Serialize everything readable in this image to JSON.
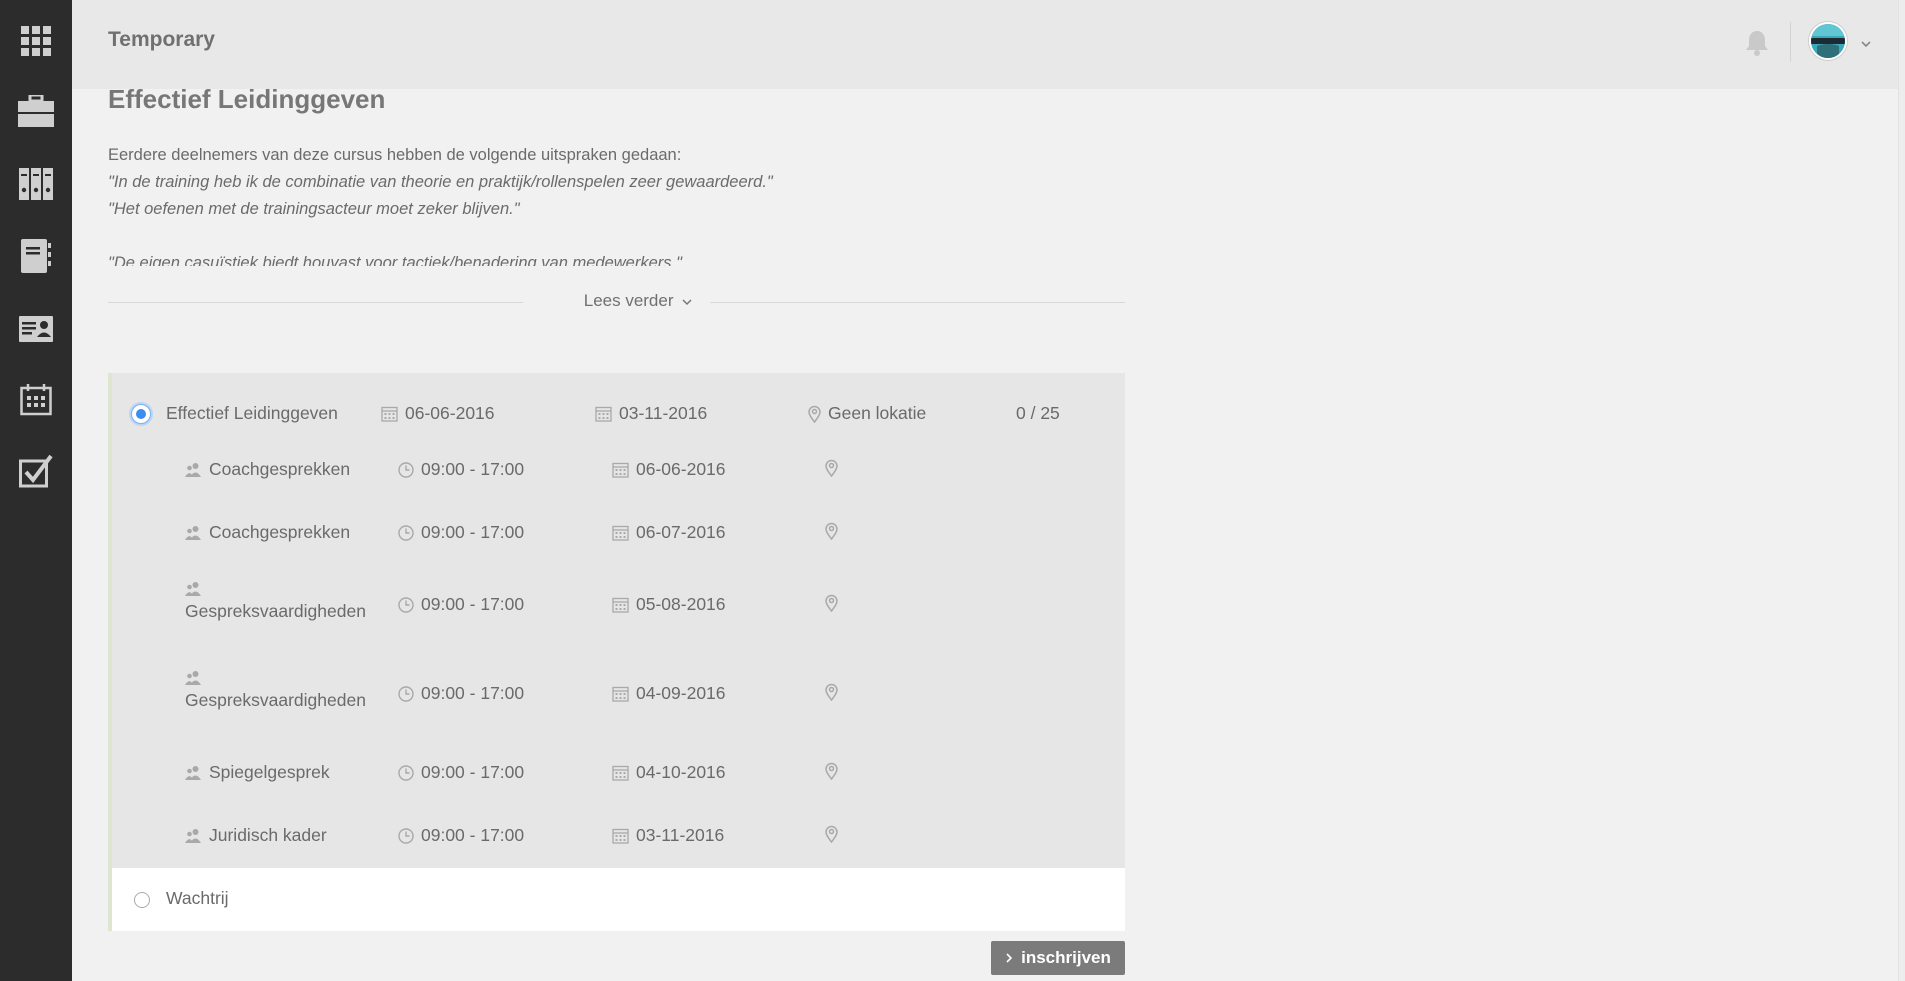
{
  "app": {
    "title": "Temporary"
  },
  "sidebar": {
    "items": [
      {
        "icon": "apps-grid-icon"
      },
      {
        "icon": "briefcase-icon"
      },
      {
        "icon": "binders-icon"
      },
      {
        "icon": "notebook-icon"
      },
      {
        "icon": "contact-card-icon"
      },
      {
        "icon": "calendar-icon"
      },
      {
        "icon": "checkbox-icon"
      }
    ]
  },
  "topbar": {
    "notifications_icon": "bell-icon",
    "avatar_icon": "user-avatar"
  },
  "course": {
    "title": "Effectief Leidinggeven",
    "intro": "Eerdere deelnemers van deze cursus hebben de volgende uitspraken gedaan:",
    "quotes": [
      "\"In de training heb ik de combinatie van theorie en praktijk/rollenspelen zeer gewaardeerd.\"",
      "\"Het oefenen met de trainingsacteur moet zeker blijven.\"",
      "\"De eigen casuïstiek biedt houvast voor tactiek/benadering van medewerkers.\""
    ],
    "read_more": "Lees verder"
  },
  "edition": {
    "name": "Effectief Leidinggeven",
    "start_date": "06-06-2016",
    "end_date": "03-11-2016",
    "location": "Geen lokatie",
    "capacity": "0 / 25",
    "selected": true
  },
  "sessions": [
    {
      "name": "Coachgesprekken",
      "time": "09:00 - 17:00",
      "date": "06-06-2016"
    },
    {
      "name": "Coachgesprekken",
      "time": "09:00 - 17:00",
      "date": "06-07-2016"
    },
    {
      "name": "Gespreksvaardigheden",
      "time": "09:00 - 17:00",
      "date": "05-08-2016"
    },
    {
      "name": "Gespreksvaardigheden",
      "time": "09:00 - 17:00",
      "date": "04-09-2016"
    },
    {
      "name": "Spiegelgesprek",
      "time": "09:00 - 17:00",
      "date": "04-10-2016"
    },
    {
      "name": "Juridisch kader",
      "time": "09:00 - 17:00",
      "date": "03-11-2016"
    }
  ],
  "waitlist": {
    "label": "Wachtrij",
    "selected": false
  },
  "actions": {
    "enroll_label": "inschrijven"
  },
  "colors": {
    "sidebar": "#2c2c2c",
    "topbar": "#e8e8e8",
    "selected_radio": "#3b8df0",
    "button": "#7b7b7b"
  }
}
